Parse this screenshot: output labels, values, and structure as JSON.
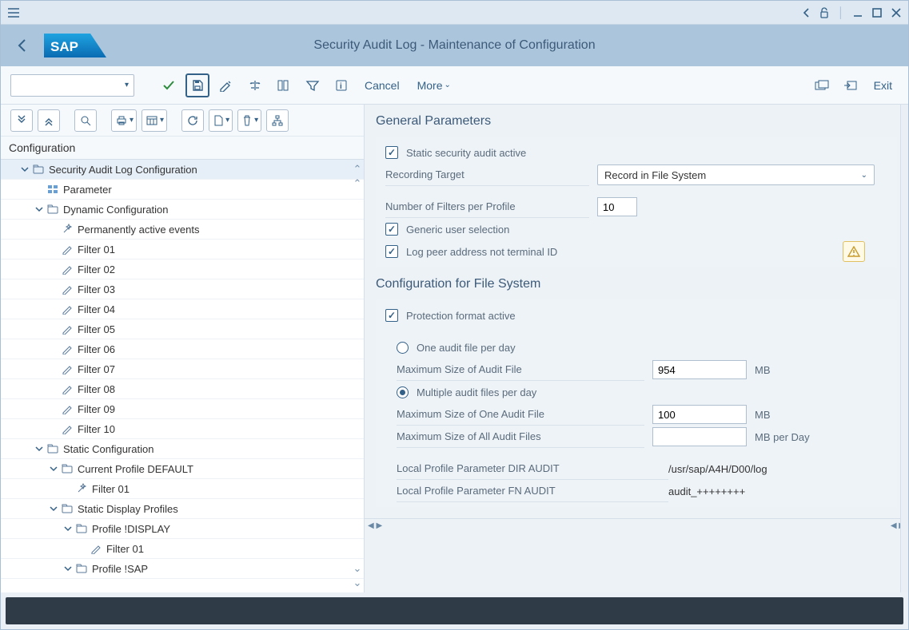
{
  "titlebar": {},
  "header": {
    "title": "Security Audit Log - Maintenance of Configuration"
  },
  "toolbar": {
    "cancel": "Cancel",
    "more": "More",
    "exit": "Exit"
  },
  "left": {
    "heading": "Configuration",
    "tree": [
      {
        "indent": 1,
        "expander": "open",
        "icon": "folder",
        "label": "Security Audit Log Configuration",
        "sel": true
      },
      {
        "indent": 2,
        "expander": "none",
        "icon": "param",
        "label": "Parameter"
      },
      {
        "indent": 2,
        "expander": "open",
        "icon": "folder",
        "label": "Dynamic Configuration"
      },
      {
        "indent": 3,
        "expander": "none",
        "icon": "wand",
        "label": "Permanently active events"
      },
      {
        "indent": 3,
        "expander": "none",
        "icon": "pencil",
        "label": "Filter 01"
      },
      {
        "indent": 3,
        "expander": "none",
        "icon": "pencil",
        "label": "Filter 02"
      },
      {
        "indent": 3,
        "expander": "none",
        "icon": "pencil",
        "label": "Filter 03"
      },
      {
        "indent": 3,
        "expander": "none",
        "icon": "pencil",
        "label": "Filter 04"
      },
      {
        "indent": 3,
        "expander": "none",
        "icon": "pencil",
        "label": "Filter 05"
      },
      {
        "indent": 3,
        "expander": "none",
        "icon": "pencil",
        "label": "Filter 06"
      },
      {
        "indent": 3,
        "expander": "none",
        "icon": "pencil",
        "label": "Filter 07"
      },
      {
        "indent": 3,
        "expander": "none",
        "icon": "pencil",
        "label": "Filter 08"
      },
      {
        "indent": 3,
        "expander": "none",
        "icon": "pencil",
        "label": "Filter 09"
      },
      {
        "indent": 3,
        "expander": "none",
        "icon": "pencil",
        "label": "Filter 10"
      },
      {
        "indent": 2,
        "expander": "open",
        "icon": "folder",
        "label": "Static Configuration"
      },
      {
        "indent": 3,
        "expander": "open",
        "icon": "folder",
        "label": "Current Profile DEFAULT"
      },
      {
        "indent": 4,
        "expander": "none",
        "icon": "wand",
        "label": "Filter 01"
      },
      {
        "indent": 3,
        "expander": "open",
        "icon": "folder",
        "label": "Static Display Profiles"
      },
      {
        "indent": 4,
        "expander": "open",
        "icon": "folder",
        "label": "Profile !DISPLAY"
      },
      {
        "indent": 5,
        "expander": "none",
        "icon": "pencil",
        "label": "Filter 01"
      },
      {
        "indent": 4,
        "expander": "open",
        "icon": "folder",
        "label": "Profile !SAP"
      }
    ]
  },
  "right": {
    "general": {
      "title": "General Parameters",
      "static_active_label": "Static security audit active",
      "static_active": true,
      "recording_target_label": "Recording Target",
      "recording_target_value": "Record in File System",
      "num_filters_label": "Number of Filters per Profile",
      "num_filters_value": "10",
      "generic_user_label": "Generic user selection",
      "generic_user": true,
      "log_peer_label": "Log peer address not terminal ID",
      "log_peer": true
    },
    "filesys": {
      "title": "Configuration for File System",
      "protection_label": "Protection format active",
      "protection": true,
      "opt_one_label": "One audit file per day",
      "opt_one": false,
      "max_size_label": "Maximum Size of Audit File",
      "max_size_value": "954",
      "unit_mb": "MB",
      "opt_multi_label": "Multiple audit files per day",
      "opt_multi": true,
      "max_one_label": "Maximum Size of One Audit File",
      "max_one_value": "100",
      "max_all_label": "Maximum Size of All Audit Files",
      "max_all_value": "",
      "unit_mbday": "MB per Day",
      "dir_audit_label": "Local Profile Parameter DIR AUDIT",
      "dir_audit_value": "/usr/sap/A4H/D00/log",
      "fn_audit_label": "Local Profile Parameter FN AUDIT",
      "fn_audit_value": "audit_++++++++"
    }
  }
}
